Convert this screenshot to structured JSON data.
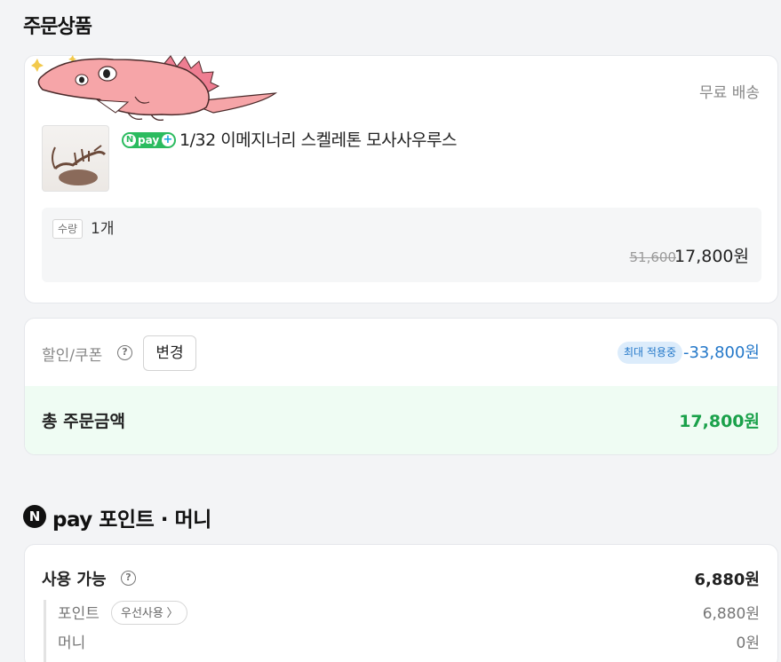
{
  "order_section": {
    "title": "주문상품"
  },
  "product_card": {
    "shipping": "무료 배송",
    "npay_badge": {
      "n": "N",
      "label": "pay",
      "plus": "+"
    },
    "product_name": "1/32 이메지너리 스켈레톤 모사사우루스",
    "quantity_label": "수량",
    "quantity_value": "1개",
    "original_price": "51,600",
    "sale_price": "17,800원"
  },
  "discount_card": {
    "label": "할인/쿠폰",
    "change_button": "변경",
    "max_badge": "최대 적용중",
    "discount_amount": "-33,800원",
    "total_label": "총 주문금액",
    "total_value": "17,800원"
  },
  "npay_section": {
    "n": "N",
    "title": "pay 포인트 · 머니"
  },
  "points_card": {
    "available_label": "사용 가능",
    "available_value": "6,880원",
    "point_label": "포인트",
    "priority_button": "우선사용 〉",
    "point_value": "6,880원",
    "money_label": "머니",
    "money_value": "0원"
  },
  "colors": {
    "accent_green": "#1aa14a",
    "accent_blue": "#2478c9",
    "total_bg": "#effcf3",
    "mascot_pink": "#f6a5a8"
  }
}
